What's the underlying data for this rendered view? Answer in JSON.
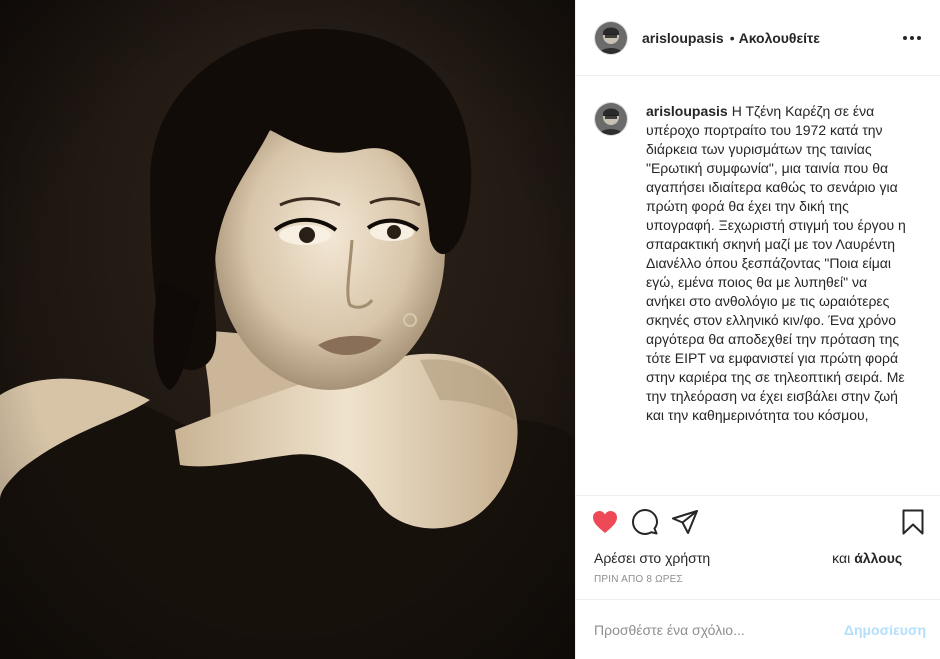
{
  "post": {
    "username": "arisloupasis",
    "separator": "•",
    "follow_status": "Ακολουθείτε",
    "more_icon": "more-options-icon",
    "caption": "Η Τζένη Καρέζη σε ένα υπέροχο πορτραίτο του 1972 κατά την διάρκεια των γυρισμάτων της ταινίας \"Ερωτική συμφωνία\", μια ταινία που θα αγαπήσει ιδιαίτερα καθώς το σενάριο για πρώτη φορά θα έχει την δική της υπογραφή. Ξεχωριστή στιγμή του έργου η σπαρακτική σκηνή μαζί με τον Λαυρέντη Διανέλλο όπου ξεσπάζοντας \"Ποια είμαι εγώ, εμένα ποιος θα με λυπηθεί\" να ανήκει στο ανθολόγιο με τις ωραιότερες σκηνές στον ελληνικό κιν/φο. Ένα χρόνο αργότερα θα αποδεχθεί την πρόταση της τότε ΕΙΡΤ να εμφανιστεί για πρώτη φορά στην καριέρα της σε τηλεοπτική σειρά. Με την τηλεόραση να έχει εισβάλει στην ζωή και την καθημερινότητα του κόσμου,"
  },
  "actions": {
    "like_icon": "heart-filled-icon",
    "comment_icon": "comment-icon",
    "share_icon": "share-icon",
    "save_icon": "bookmark-icon",
    "like_color": "#ed4956"
  },
  "likes": {
    "prefix": "Αρέσει στο χρήστη",
    "and": "και",
    "others": "άλλους"
  },
  "timestamp": "ΠΡΙΝ ΑΠΟ 8 ΩΡΕΣ",
  "comment": {
    "placeholder": "Προσθέστε ένα σχόλιο...",
    "post_label": "Δημοσίευση",
    "post_color": "#b2dffc"
  }
}
